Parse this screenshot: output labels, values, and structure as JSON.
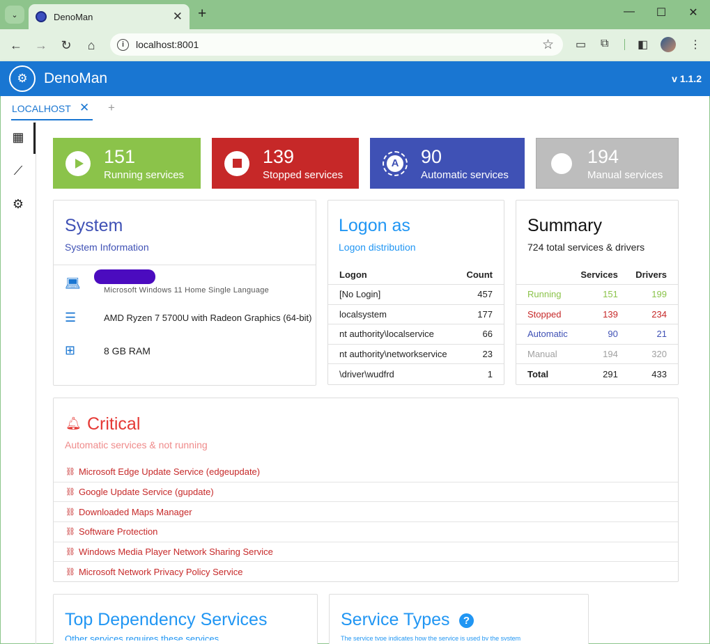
{
  "browser": {
    "tab_title": "DenoMan",
    "url": "localhost:8001"
  },
  "app": {
    "title": "DenoMan",
    "version": "v 1.1.2",
    "host_tab": "LOCALHOST"
  },
  "stats": [
    {
      "value": "151",
      "label": "Running services",
      "color": "#8bc34a"
    },
    {
      "value": "139",
      "label": "Stopped services",
      "color": "#c62828"
    },
    {
      "value": "90",
      "label": "Automatic services",
      "color": "#3f51b5"
    },
    {
      "value": "194",
      "label": "Manual services",
      "color": "#bdbdbd"
    }
  ],
  "system": {
    "title": "System",
    "subtitle": "System Information",
    "os": "Microsoft Windows 11 Home Single Language",
    "cpu": "AMD Ryzen 7 5700U with Radeon Graphics (64-bit)",
    "ram": "8 GB RAM"
  },
  "logon": {
    "title": "Logon as",
    "subtitle": "Logon distribution",
    "col_logon": "Logon",
    "col_count": "Count",
    "rows": [
      {
        "name": "[No Login]",
        "count": "457"
      },
      {
        "name": "localsystem",
        "count": "177"
      },
      {
        "name": "nt authority\\localservice",
        "count": "66"
      },
      {
        "name": "nt authority\\networkservice",
        "count": "23"
      },
      {
        "name": "\\driver\\wudfrd",
        "count": "1"
      }
    ]
  },
  "summary": {
    "title": "Summary",
    "subtitle": "724 total services & drivers",
    "col_services": "Services",
    "col_drivers": "Drivers",
    "rows": [
      {
        "label": "Running",
        "services": "151",
        "drivers": "199",
        "color": "#8bc34a"
      },
      {
        "label": "Stopped",
        "services": "139",
        "drivers": "234",
        "color": "#c62828"
      },
      {
        "label": "Automatic",
        "services": "90",
        "drivers": "21",
        "color": "#3f51b5"
      },
      {
        "label": "Manual",
        "services": "194",
        "drivers": "320",
        "color": "#a0a0a0"
      },
      {
        "label": "Total",
        "services": "291",
        "drivers": "433",
        "color": "#222222"
      }
    ]
  },
  "critical": {
    "title": "Critical",
    "subtitle": "Automatic services & not running",
    "items": [
      "Microsoft Edge Update Service (edgeupdate)",
      "Google Update Service (gupdate)",
      "Downloaded Maps Manager",
      "Software Protection",
      "Windows Media Player Network Sharing Service",
      "Microsoft Network Privacy Policy Service"
    ]
  },
  "dependency": {
    "title": "Top Dependency Services",
    "subtitle": "Other services requires these services"
  },
  "service_types": {
    "title": "Service Types",
    "subtitle": "The service type indicates how the service is used by the system"
  }
}
